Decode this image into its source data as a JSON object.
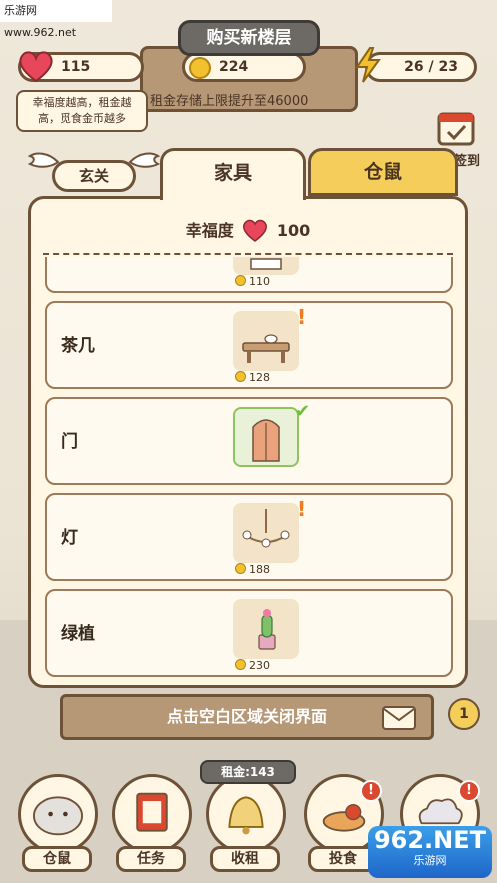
{
  "watermark": "乐游网 www.962.net",
  "hud": {
    "floor_title": "购买新楼层",
    "happiness_value": "115",
    "coins_value": "224",
    "energy_value": "26 / 23",
    "rent_info": "租金存储上限提升至46000",
    "tip": "幸福度越高，租金越高，觅食金币越多",
    "sign_in": "签到"
  },
  "tabs": {
    "entrance": "玄关",
    "furniture": "家具",
    "hamster": "仓鼠"
  },
  "panel": {
    "happiness_label": "幸福度",
    "happiness_value": "100",
    "items": [
      {
        "name": "",
        "price": "110",
        "state": "partial"
      },
      {
        "name": "茶几",
        "price": "128",
        "state": "upgrade"
      },
      {
        "name": "门",
        "price": "",
        "state": "owned"
      },
      {
        "name": "灯",
        "price": "188",
        "state": "upgrade"
      },
      {
        "name": "绿植",
        "price": "230",
        "state": "none"
      }
    ]
  },
  "close_hint": "点击空白区域关闭界面",
  "bubble_count": "1",
  "rent_label": "租金:143",
  "bottom_nav": [
    {
      "label": "仓鼠"
    },
    {
      "label": "任务"
    },
    {
      "label": "收租"
    },
    {
      "label": "投食"
    },
    {
      "label": ""
    }
  ],
  "notify_mark": "!",
  "logo": {
    "big": "962.NET",
    "small": "乐游网"
  },
  "colors": {
    "accent_orange": "#ef7a21",
    "owned_green": "#8fc35c",
    "tab_yellow": "#f5cd5a",
    "heart_red": "#e8465a"
  }
}
